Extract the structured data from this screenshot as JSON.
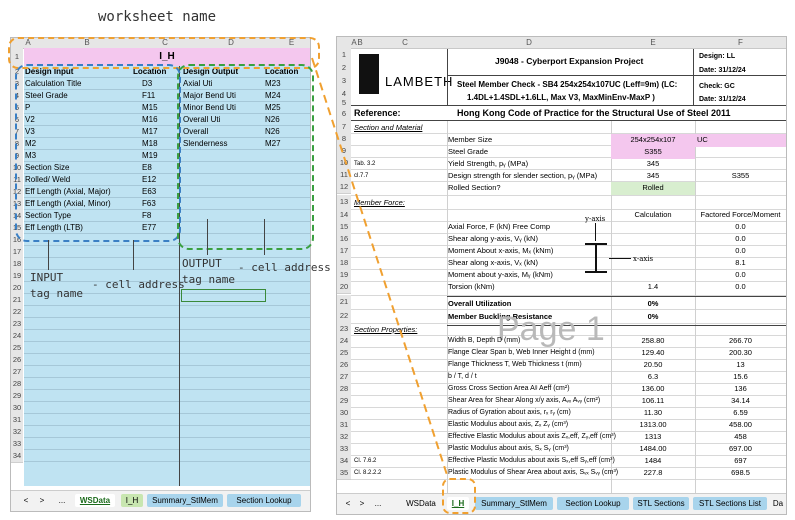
{
  "annotations": {
    "worksheet_name": "worksheet name",
    "input_tag": "INPUT\ntag name",
    "cell_address_1": "- cell address",
    "output_tag": "OUTPUT\ntag name",
    "cell_address_2": "- cell address"
  },
  "left": {
    "col_headers": [
      "A",
      "B",
      "C",
      "D",
      "E"
    ],
    "sheet_title": "I_H",
    "headers": {
      "design_input": "Design Input",
      "location1": "Location",
      "design_output": "Design Output",
      "location2": "Location"
    },
    "inputs": [
      {
        "name": "Calculation Title",
        "loc": "D3"
      },
      {
        "name": "Steel Grade",
        "loc": "F11"
      },
      {
        "name": "P",
        "loc": "M15"
      },
      {
        "name": "V2",
        "loc": "M16"
      },
      {
        "name": "V3",
        "loc": "M17"
      },
      {
        "name": "M2",
        "loc": "M18"
      },
      {
        "name": "M3",
        "loc": "M19"
      },
      {
        "name": "Section Size",
        "loc": "E8"
      },
      {
        "name": "Rolled/ Weld",
        "loc": "E12"
      },
      {
        "name": "Eff Length (Axial, Major)",
        "loc": "E63"
      },
      {
        "name": "Eff Length (Axial, Minor)",
        "loc": "F63"
      },
      {
        "name": "Section Type",
        "loc": "F8"
      },
      {
        "name": "Eff Length (LTB)",
        "loc": "E77"
      }
    ],
    "outputs": [
      {
        "name": "Axial Uti",
        "loc": "M23"
      },
      {
        "name": "Major Bend Uti",
        "loc": "M24"
      },
      {
        "name": "Minor Bend Uti",
        "loc": "M25"
      },
      {
        "name": "Overall Uti",
        "loc": "N26"
      },
      {
        "name": "Overall",
        "loc": "N26"
      },
      {
        "name": "Slenderness",
        "loc": "M27"
      }
    ],
    "tabs": [
      "WSData",
      "I_H",
      "Summary_StlMem",
      "Section Lookup"
    ],
    "nav": [
      "<",
      ">",
      "..."
    ]
  },
  "right": {
    "col_headers": [
      "A",
      "B",
      "C",
      "D",
      "E",
      "F"
    ],
    "logo_text": "LAMBETH",
    "project": "J9048 - Cyberport Expansion Project",
    "design_by": "Design: LL",
    "date1": "Date:  31/12/24",
    "check_by": "Check: GC",
    "date2": "Date:  31/12/24",
    "subtitle1": "Steel Member Check - SB4 254x254x107UC (Leff=9m) (LC:",
    "subtitle2": "1.4DL+1.4SDL+1.6LL, Max V3, MaxMinEnv-MaxP )",
    "reference_label": "Reference:",
    "reference_value": "Hong Kong Code of Practice for the Structural Use of Steel 2011",
    "section_material": "Section and Material",
    "member_size_label": "Member Size",
    "member_size": "254x254x107",
    "member_type": "UC",
    "steel_grade_label": "Steel Grade",
    "steel_grade": "S355",
    "tab32": "Tab. 3.2",
    "yield_label": "Yield Strength, pᵧ (MPa)",
    "yield_value": "345",
    "cl77": "cl.7.7",
    "design_strength_label": "Design strength for slender section, pᵧ (MPa)",
    "design_strength_value": "345",
    "design_strength_grade": "S355",
    "rolled_label": "Rolled Section?",
    "rolled_value": "Rolled",
    "member_force": "Member Force:",
    "calc_header": "Calculation",
    "factored_header": "Factored Force/Moment",
    "forces": [
      {
        "label": "Axial Force, F (kN) Free Comp",
        "calc": "",
        "fact": "0.0"
      },
      {
        "label": "Shear along y-axis, Vᵧ (kN)",
        "calc": "",
        "fact": "0.0"
      },
      {
        "label": "Moment About x-axis, Mₓ (kNm)",
        "calc": "",
        "fact": "0.0"
      },
      {
        "label": "Shear along x-axis, Vₓ (kN)",
        "calc": "",
        "fact": "8.1"
      },
      {
        "label": "Moment about y-axis, Mᵧ (kNm)",
        "calc": "",
        "fact": "0.0"
      },
      {
        "label": "Torsion (kNm)",
        "calc": "1.4",
        "fact": "0.0"
      }
    ],
    "yaxis": "y-axis",
    "xaxis": "x-axis",
    "overall_util_label": "Overall Utilization",
    "overall_util_value": "0%",
    "buckling_label": "Member Buckling Resistance",
    "buckling_value": "0%",
    "page_watermark": "Page 1",
    "section_properties": "Section Properties:",
    "props": [
      {
        "ref": "",
        "label": "Width B, Depth D (mm)",
        "e": "258.80",
        "f": "266.70"
      },
      {
        "ref": "",
        "label": "Flange Clear Span b, Web Inner Height d (mm)",
        "e": "129.40",
        "f": "200.30"
      },
      {
        "ref": "",
        "label": "Flange Thickness T, Web Thickness t (mm)",
        "e": "20.50",
        "f": "13"
      },
      {
        "ref": "",
        "label": "b / T,  d / t",
        "e": "6.3",
        "f": "15.6"
      },
      {
        "ref": "",
        "label": "Gross Cross Section Area Aᵍ Aeff (cm²)",
        "e": "136.00",
        "f": "136"
      },
      {
        "ref": "",
        "label": "Shear Area for Shear Along x/y axis, Aᵥₓ Aᵥᵧ (cm²)",
        "e": "106.11",
        "f": "34.14"
      },
      {
        "ref": "",
        "label": "Radius of Gyration about axis, rₓ rᵧ (cm)",
        "e": "11.30",
        "f": "6.59"
      },
      {
        "ref": "",
        "label": "Elastic Modulus about axis, Zₓ Zᵧ (cm³)",
        "e": "1313.00",
        "f": "458.00"
      },
      {
        "ref": "",
        "label": "Effective Elastic Modulus about axis Zₓ,eff, Zᵧ,eff (cm³)",
        "e": "1313",
        "f": "458"
      },
      {
        "ref": "",
        "label": "Plastic Modulus about axis, Sₓ Sᵧ (cm³)",
        "e": "1484.00",
        "f": "697.00"
      },
      {
        "ref": "Cl. 7.6.2",
        "label": "Effective Plastic Modulus about axis Sₓ,eff Sᵧ,eff (cm³)",
        "e": "1484",
        "f": "697"
      },
      {
        "ref": "Cl. 8.2.2.2",
        "label": "Plastic Modulus of Shear Area about axis, Sᵥₓ Sᵥᵧ (cm³)",
        "e": "227.8",
        "f": "698.5"
      }
    ],
    "tabs": [
      "WSData",
      "I_H",
      "Summary_StlMem",
      "Section Lookup",
      "STL Sections",
      "STL Sections List",
      "Da"
    ],
    "nav": [
      "<",
      ">",
      "..."
    ]
  }
}
